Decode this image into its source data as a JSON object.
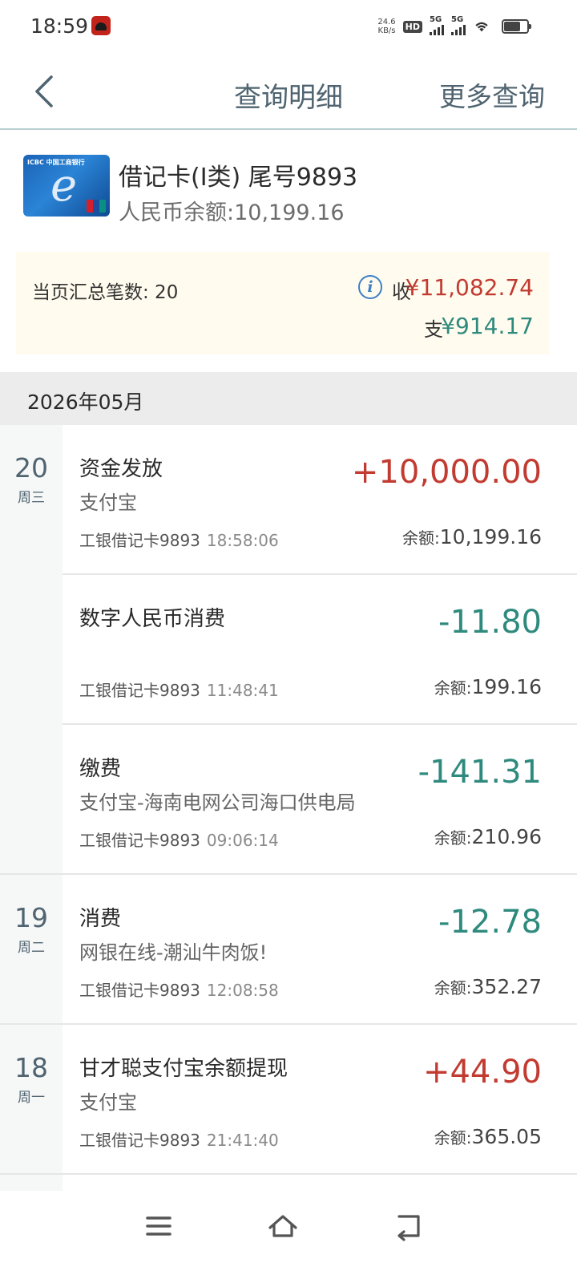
{
  "status_bar": {
    "time": "18:59",
    "speed_value": "24.6",
    "speed_unit": "KB/s",
    "hd_label": "HD",
    "sim1_label": "5G",
    "sim2_label": "5G",
    "icons": [
      "notification-app-icon",
      "hd-voice-icon",
      "signal-icon",
      "signal-icon",
      "wifi-icon",
      "battery-icon"
    ]
  },
  "nav": {
    "back_icon": "chevron-left-icon",
    "title": "查询明细",
    "more_label": "更多查询"
  },
  "card": {
    "name": "借记卡(Ⅰ类) 尾号9893",
    "balance": "人民币余额:10,199.16",
    "image_text": "ICBC 中国工商银行"
  },
  "summary": {
    "count_label": "当页汇总笔数: 20",
    "info_icon": "info-icon",
    "income_label": "收",
    "income_value": "¥11,082.74",
    "expense_label": "支",
    "expense_value": "¥914.17"
  },
  "month": "2026年05月",
  "days": [
    {
      "num": "20",
      "weekday": "周三"
    },
    {
      "num": "19",
      "weekday": "周二"
    },
    {
      "num": "18",
      "weekday": "周一"
    }
  ],
  "transactions": [
    {
      "title": "资金发放",
      "sub": "支付宝",
      "card": "工银借记卡9893",
      "time": "18:58:06",
      "amount": "+10,000.00",
      "balance_label": "余额:",
      "balance": "10,199.16"
    },
    {
      "title": "数字人民币消费",
      "sub": "",
      "card": "工银借记卡9893",
      "time": "11:48:41",
      "amount": "-11.80",
      "balance_label": "余额:",
      "balance": "199.16"
    },
    {
      "title": "缴费",
      "sub": "支付宝-海南电网公司海口供电局",
      "card": "工银借记卡9893",
      "time": "09:06:14",
      "amount": "-141.31",
      "balance_label": "余额:",
      "balance": "210.96"
    },
    {
      "title": "消费",
      "sub": "网银在线-潮汕牛肉饭!",
      "card": "工银借记卡9893",
      "time": "12:08:58",
      "amount": "-12.78",
      "balance_label": "余额:",
      "balance": "352.27"
    },
    {
      "title": "甘才聪支付宝余额提现",
      "sub": "支付宝",
      "card": "工银借记卡9893",
      "time": "21:41:40",
      "amount": "+44.90",
      "balance_label": "余额:",
      "balance": "365.05"
    }
  ],
  "colors": {
    "income": "#c23b31",
    "expense": "#2f8a7e",
    "nav_text": "#4f6470",
    "summary_bg": "#fffbee"
  },
  "system_nav": [
    "menu-icon",
    "home-icon",
    "back-icon"
  ]
}
